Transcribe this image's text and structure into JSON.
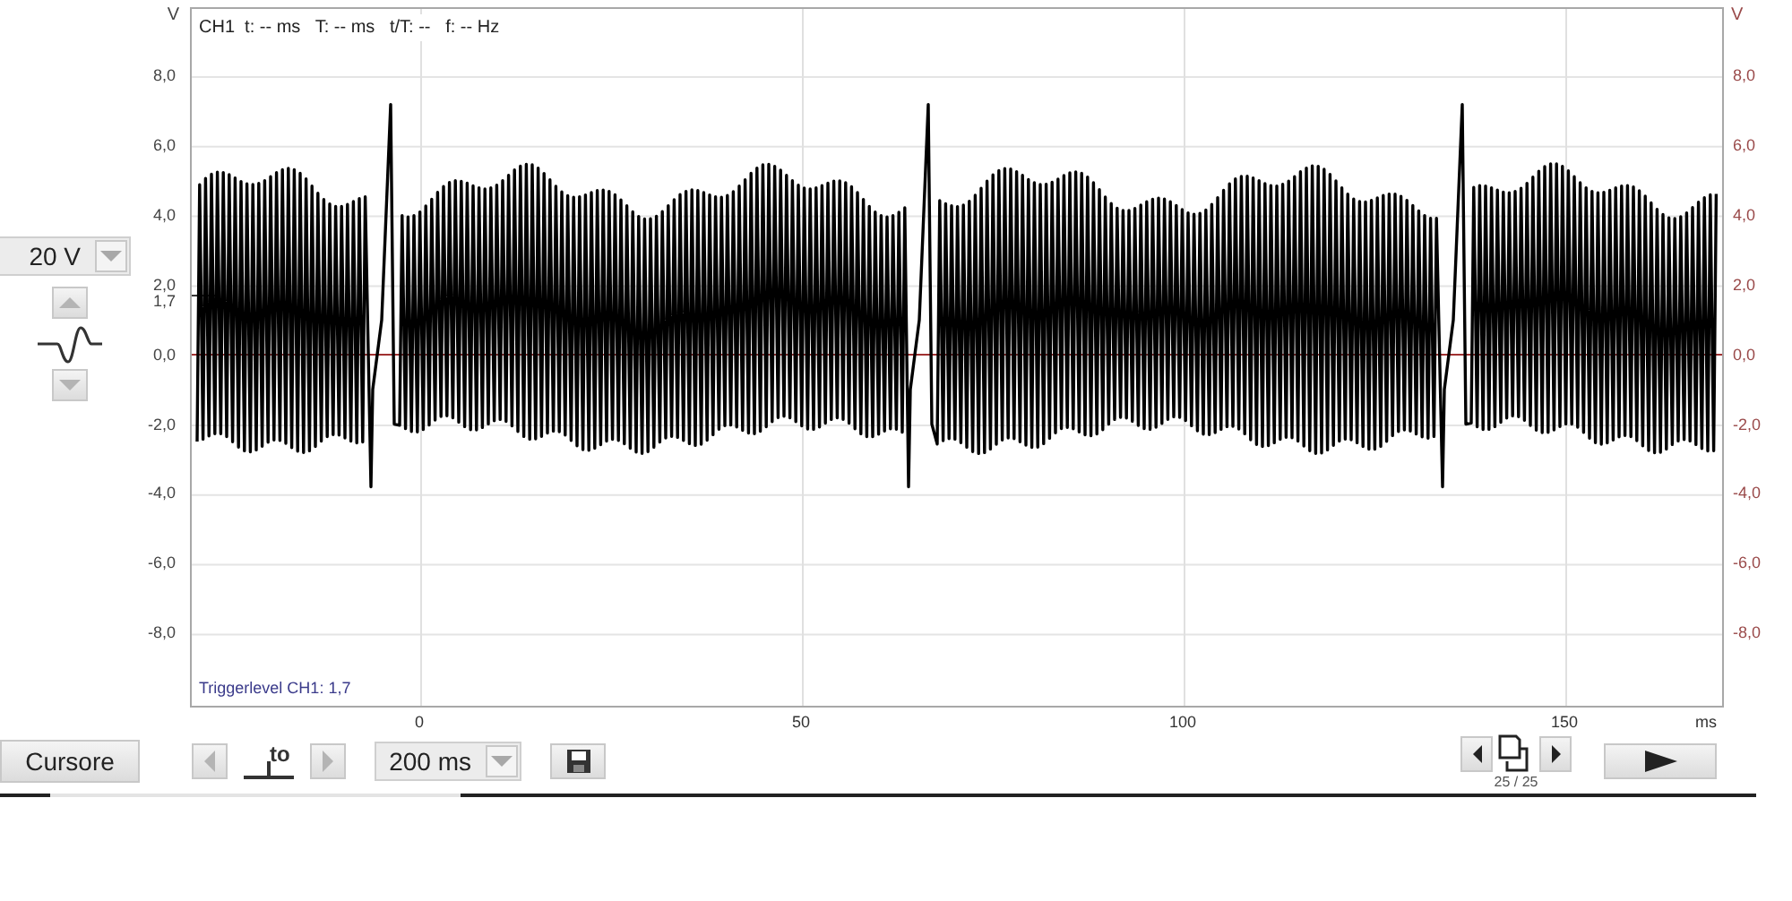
{
  "plot": {
    "readout": "CH1  t: -- ms   T: -- ms   t/T: --   f: -- Hz",
    "trigger_text": "Triggerlevel CH1: 1,7",
    "trigger_marker": "1,7"
  },
  "y_axis_left": {
    "unit": "V",
    "ticks": [
      "8,0",
      "6,0",
      "4,0",
      "2,0",
      "0,0",
      "-2,0",
      "-4,0",
      "-6,0",
      "-8,0"
    ]
  },
  "y_axis_right": {
    "unit": "V",
    "ticks": [
      "8,0",
      "6,0",
      "4,0",
      "2,0",
      "0,0",
      "-2,0",
      "-4,0",
      "-6,0",
      "-8,0"
    ]
  },
  "x_axis": {
    "ticks": [
      "0",
      "50",
      "100",
      "150"
    ],
    "unit": "ms"
  },
  "volts_dropdown": {
    "value": "20 V"
  },
  "controls": {
    "cursor_button": "Cursore",
    "trigger_label": "to",
    "timebase_dropdown": "200 ms",
    "page_counter": "25 / 25"
  }
}
